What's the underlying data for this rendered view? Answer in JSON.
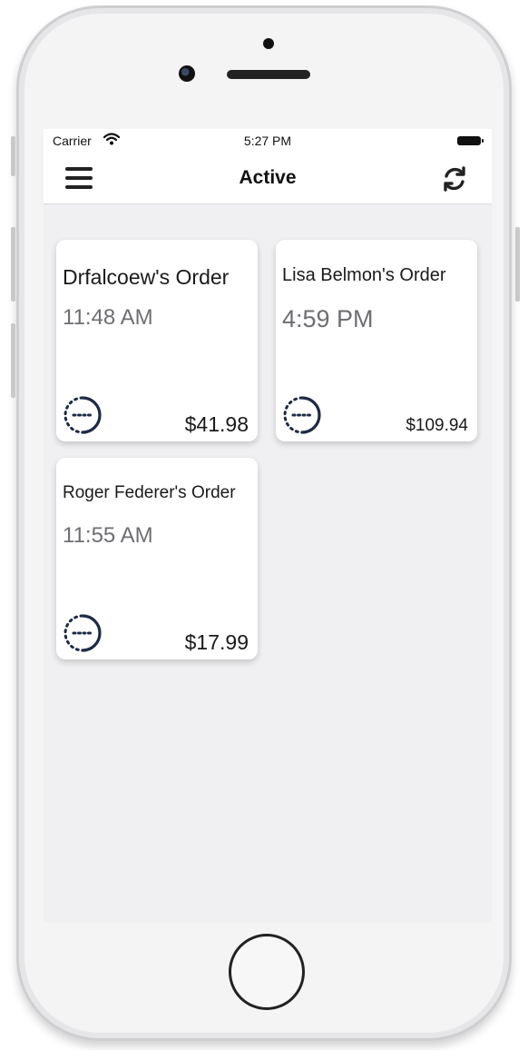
{
  "status_bar": {
    "carrier": "Carrier",
    "time": "5:27 PM"
  },
  "nav": {
    "title": "Active",
    "menu_icon": "hamburger-menu-icon",
    "refresh_icon": "refresh-icon"
  },
  "orders": [
    {
      "name": "Drfalcoew's Order",
      "time": "11:48 AM",
      "price": "$41.98",
      "status_icon": "in-progress-icon"
    },
    {
      "name": "Lisa Belmon's Order",
      "time": "4:59 PM",
      "price": "$109.94",
      "status_icon": "in-progress-icon"
    },
    {
      "name": "Roger Federer's Order",
      "time": "11:55 AM",
      "price": "$17.99",
      "status_icon": "in-progress-icon"
    }
  ],
  "colors": {
    "background": "#f0f0f2",
    "card": "#ffffff",
    "accent": "#1f2a44",
    "muted_text": "#6e6e73"
  }
}
